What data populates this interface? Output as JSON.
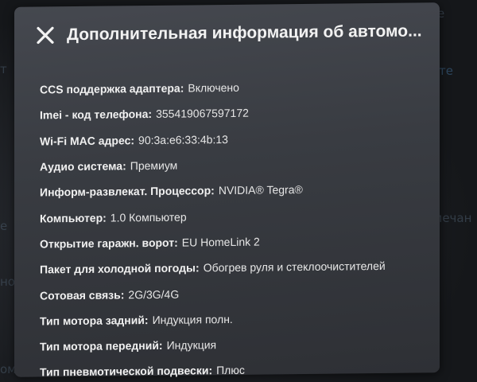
{
  "background": {
    "left_fragments": [
      "т",
      "е",
      "нос",
      "омн"
    ],
    "right_fragments": [
      "те",
      "мечан",
      "е"
    ]
  },
  "dialog": {
    "title": "Дополнительная информация об автомо...",
    "close_icon": "close-icon",
    "rows": [
      {
        "label": "CCS поддержка адаптера:",
        "value": "Включено"
      },
      {
        "label": "Imei - код телефона:",
        "value": "355419067597172"
      },
      {
        "label": "Wi-Fi MAC адрес:",
        "value": "90:3a:e6:33:4b:13"
      },
      {
        "label": "Аудио система:",
        "value": "Премиум"
      },
      {
        "label": "Информ-развлекат. Процессор:",
        "value": "NVIDIA® Tegra®"
      },
      {
        "label": "Компьютер:",
        "value": "1.0 Компьютер"
      },
      {
        "label": "Открытие гаражн. ворот:",
        "value": "EU HomeLink 2"
      },
      {
        "label": "Пакет для холодной погоды:",
        "value": "Обогрев руля и стеклоочистителей"
      },
      {
        "label": "Сотовая связь:",
        "value": "2G/3G/4G"
      },
      {
        "label": "Тип мотора задний:",
        "value": "Индукция полн."
      },
      {
        "label": "Тип мотора передний:",
        "value": "Индукция"
      },
      {
        "label": "Тип пневмотической подвески:",
        "value": "Плюс"
      }
    ]
  }
}
